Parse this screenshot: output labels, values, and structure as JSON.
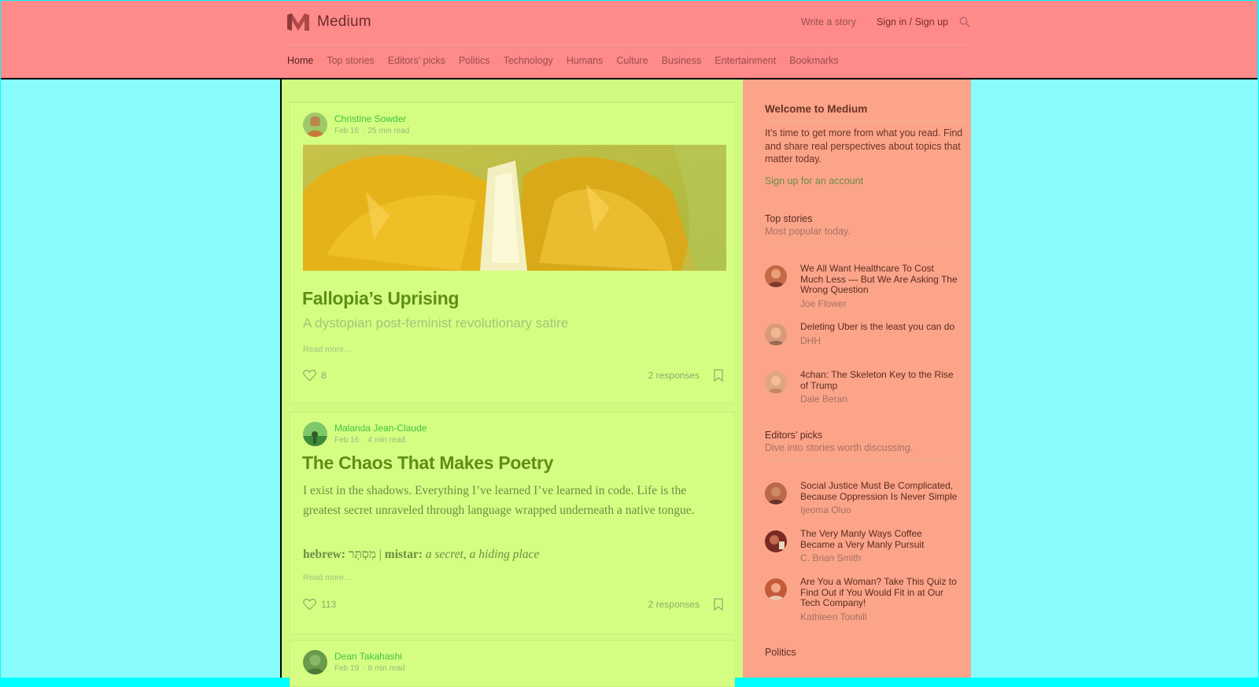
{
  "header": {
    "brand": "Medium",
    "write_link": "Write a story",
    "signin_link": "Sign in / Sign up",
    "nav": [
      {
        "label": "Home",
        "active": true
      },
      {
        "label": "Top stories",
        "active": false
      },
      {
        "label": "Editors’ picks",
        "active": false
      },
      {
        "label": "Politics",
        "active": false
      },
      {
        "label": "Technology",
        "active": false
      },
      {
        "label": "Humans",
        "active": false
      },
      {
        "label": "Culture",
        "active": false
      },
      {
        "label": "Business",
        "active": false
      },
      {
        "label": "Entertainment",
        "active": false
      },
      {
        "label": "Bookmarks",
        "active": false
      }
    ]
  },
  "posts": [
    {
      "author": "Christine Sowder",
      "date": "Feb 16",
      "read_time": "25 min read",
      "title": "Fallopia’s Uprising",
      "subtitle": "A dystopian post-feminist revolutionary satire",
      "read_more": "Read more…",
      "likes": "8",
      "responses": "2 responses"
    },
    {
      "author": "Malanda Jean-Claude",
      "date": "Feb 16",
      "read_time": "4 min read",
      "title": "The Chaos That Makes Poetry",
      "body": "I exist in the shadows. Everything I’ve learned I’ve learned in code. Life is the greatest secret unraveled through language wrapped underneath a native tongue.",
      "hebrew_label": "hebrew:",
      "hebrew_word": "מִסְתָּר",
      "hebrew_divider": "|",
      "mistar_label": "mistar:",
      "mistar_meaning": "a secret, a hiding place",
      "read_more": "Read more…",
      "likes": "113",
      "responses": "2 responses"
    },
    {
      "author": "Dean Takahashi",
      "date": "Feb 19",
      "read_time": "8 min read"
    }
  ],
  "sidebar": {
    "welcome_title": "Welcome to Medium",
    "welcome_text": "It’s time to get more from what you read. Find and share real perspectives about topics that matter today.",
    "signup_link": "Sign up for an account",
    "top_stories": {
      "title": "Top stories",
      "subtitle": "Most popular today.",
      "items": [
        {
          "title": "We All Want Healthcare To Cost Much Less — But We Are Asking The Wrong Question",
          "author": "Joe Flower"
        },
        {
          "title": "Deleting Uber is the least you can do",
          "author": "DHH"
        },
        {
          "title": "4chan: The Skeleton Key to the Rise of Trump",
          "author": "Dale Beran"
        }
      ]
    },
    "editors_picks": {
      "title": "Editors’ picks",
      "subtitle": "Dive into stories worth discussing.",
      "items": [
        {
          "title": "Social Justice Must Be Complicated, Because Oppression Is Never Simple",
          "author": "Ijeoma Oluo"
        },
        {
          "title": "The Very Manly Ways Coffee Became a Very Manly Pursuit",
          "author": "C. Brian Smith"
        },
        {
          "title": "Are You a Woman? Take This Quiz to Find Out if You Would Fit in at Our Tech Company!",
          "author": "Kathleen Toohill"
        }
      ]
    },
    "politics_title": "Politics"
  },
  "colors": {
    "header_bg": "#ff8a8a",
    "main_bg": "#d1fb80",
    "sidebar_bg": "#fba48a",
    "side_bg": "#88fcfc",
    "title_green": "#5f8e18",
    "author_green": "#3fc43f"
  }
}
